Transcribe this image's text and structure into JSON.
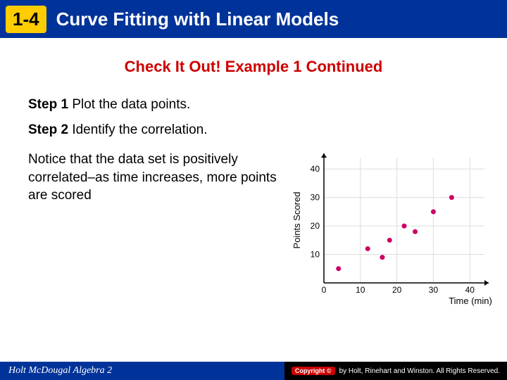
{
  "header": {
    "section_number": "1-4",
    "title": "Curve Fitting with Linear Models"
  },
  "subtitle": "Check It Out! Example 1 Continued",
  "steps": [
    {
      "label": "Step 1",
      "text": "Plot the data points."
    },
    {
      "label": "Step 2",
      "text": "Identify the correlation."
    }
  ],
  "note": "Notice that the data set is positively correlated–as time increases, more points are scored",
  "chart_data": {
    "type": "scatter",
    "xlabel": "Time (min)",
    "ylabel": "Points Scored",
    "x_ticks": [
      0,
      10,
      20,
      30,
      40
    ],
    "y_ticks": [
      0,
      10,
      20,
      30,
      40
    ],
    "xlim": [
      0,
      44
    ],
    "ylim": [
      0,
      44
    ],
    "points": [
      {
        "x": 4,
        "y": 5
      },
      {
        "x": 12,
        "y": 12
      },
      {
        "x": 16,
        "y": 9
      },
      {
        "x": 18,
        "y": 15
      },
      {
        "x": 22,
        "y": 20
      },
      {
        "x": 25,
        "y": 18
      },
      {
        "x": 30,
        "y": 25
      },
      {
        "x": 35,
        "y": 30
      }
    ]
  },
  "footer": {
    "book": "Holt McDougal Algebra 2",
    "copyright_label": "Copyright ©",
    "copyright_text": "by Holt, Rinehart and Winston. All Rights Reserved."
  }
}
